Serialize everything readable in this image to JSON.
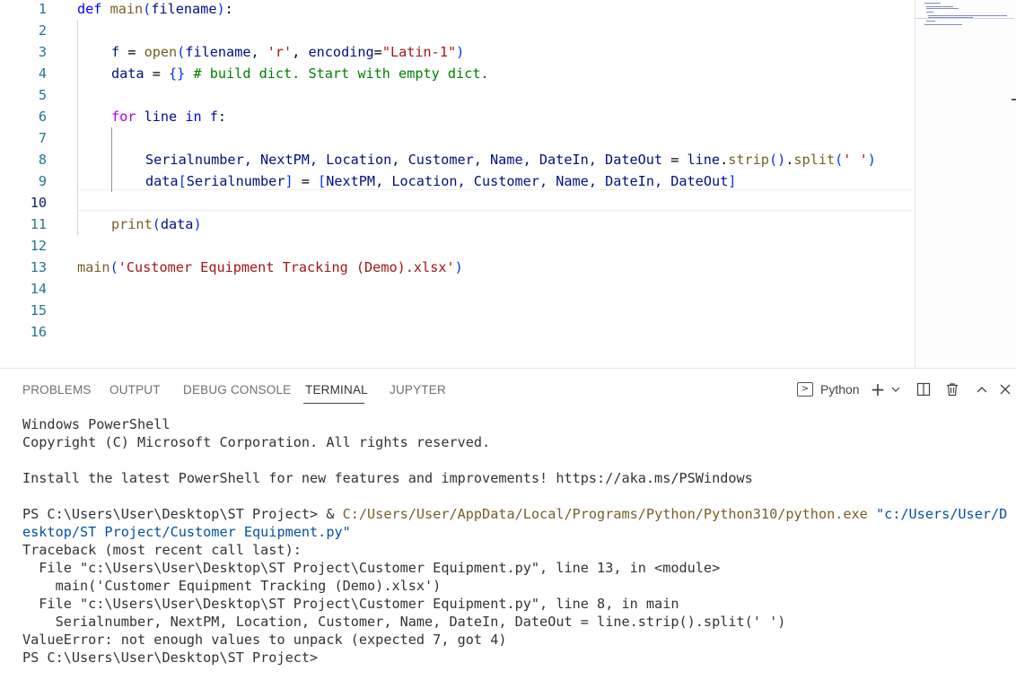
{
  "editor": {
    "line_numbers": [
      "1",
      "2",
      "3",
      "4",
      "5",
      "6",
      "7",
      "8",
      "9",
      "10",
      "11",
      "12",
      "13",
      "14",
      "15",
      "16"
    ],
    "active_line": "10",
    "code": {
      "l1": {
        "kw": "def",
        "fn": "main",
        "open": "(",
        "param": "filename",
        "close": ")",
        "colon": ":"
      },
      "l3": {
        "var": "f",
        "eq": " = ",
        "fn": "open",
        "open": "(",
        "args1": "filename, ",
        "str1": "'r'",
        "args2": ", ",
        "kwarg": "encoding",
        "eq2": "=",
        "str2": "\"Latin-1\"",
        "close": ")"
      },
      "l4": {
        "var": "data",
        "eq": " = ",
        "braces": "{}",
        "comment": " # build dict. Start with empty dict."
      },
      "l6": {
        "kw": "for",
        "v1": " line ",
        "kw2": "in",
        "v2": " f",
        "colon": ":"
      },
      "l8": {
        "lhs": "Serialnumber, NextPM, Location, Customer, Name, DateIn, DateOut",
        "eq": " = ",
        "obj": "line",
        "dot1": ".",
        "fn1": "strip",
        "p1": "()",
        "dot2": ".",
        "fn2": "split",
        "open": "(",
        "str": "' '",
        "close": ")"
      },
      "l9": {
        "var": "data",
        "open": "[",
        "key": "Serialnumber",
        "close": "]",
        "eq": " = ",
        "lopen": "[",
        "items": "NextPM, Location, Customer, Name, DateIn, DateOut",
        "lclose": "]"
      },
      "l11": {
        "fn": "print",
        "open": "(",
        "arg": "data",
        "close": ")"
      },
      "l13": {
        "fn": "main",
        "open": "(",
        "str": "'Customer Equipment Tracking (Demo).xlsx'",
        "close": ")"
      }
    }
  },
  "panel": {
    "tabs": [
      {
        "label": "PROBLEMS"
      },
      {
        "label": "OUTPUT"
      },
      {
        "label": "DEBUG CONSOLE"
      },
      {
        "label": "TERMINAL"
      },
      {
        "label": "JUPYTER"
      }
    ],
    "active_tab": "TERMINAL",
    "terminal_label": "Python",
    "icons": [
      "terminal-icon",
      "plus-icon",
      "chevron-down-icon",
      "split-icon",
      "trash-icon",
      "chevron-up-icon",
      "close-icon"
    ]
  },
  "terminal": {
    "lines": {
      "l1": "Windows PowerShell",
      "l2": "Copyright (C) Microsoft Corporation. All rights reserved.",
      "l3": "",
      "l4": "Install the latest PowerShell for new features and improvements! https://aka.ms/PSWindows",
      "l5": "",
      "prompt1": "PS C:\\Users\\User\\Desktop\\ST Project> & ",
      "exe": "C:/Users/User/AppData/Local/Programs/Python/Python310/python.exe",
      "space": " ",
      "script": "\"c:/Users/User/Desktop/ST Project/Customer Equipment.py\"",
      "l7": "Traceback (most recent call last):",
      "l8": "  File \"c:\\Users\\User\\Desktop\\ST Project\\Customer Equipment.py\", line 13, in <module>",
      "l9": "    main('Customer Equipment Tracking (Demo).xlsx')",
      "l10": "  File \"c:\\Users\\User\\Desktop\\ST Project\\Customer Equipment.py\", line 8, in main",
      "l11": "    Serialnumber, NextPM, Location, Customer, Name, DateIn, DateOut = line.strip().split(' ')",
      "l12": "ValueError: not enough values to unpack (expected 7, got 4)",
      "l13": "PS C:\\Users\\User\\Desktop\\ST Project>"
    }
  },
  "colors": {
    "keyword": "#0000ff",
    "control": "#af00db",
    "function": "#795e26",
    "variable": "#001080",
    "string": "#a31515",
    "comment": "#008000",
    "line_number": "#237893"
  }
}
